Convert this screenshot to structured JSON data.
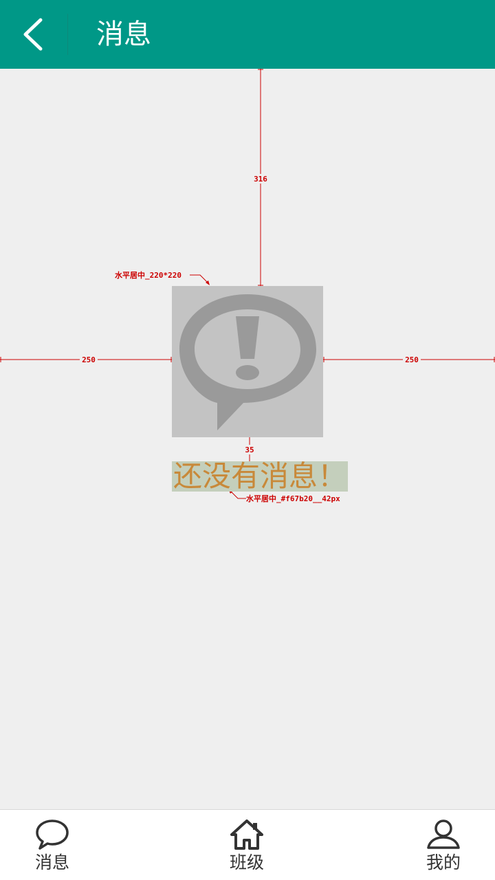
{
  "header": {
    "title": "消息",
    "back_icon": "chevron-left-icon"
  },
  "colors": {
    "header_bg": "#009887",
    "page_bg": "#efefef",
    "annotation": "#cc0000",
    "empty_text": "#c8893a"
  },
  "annotations": {
    "top_distance": "316",
    "left_distance": "250",
    "right_distance": "250",
    "icon_text_gap": "35",
    "icon_note": "水平居中_220*220",
    "text_note": "水平居中_#f67b20__42px"
  },
  "empty_state": {
    "icon": "message-alert-icon",
    "text": "还没有消息！"
  },
  "bottom_nav": {
    "items": [
      {
        "label": "消息",
        "icon": "chat-bubble-icon"
      },
      {
        "label": "班级",
        "icon": "home-icon"
      },
      {
        "label": "我的",
        "icon": "user-icon"
      }
    ]
  }
}
